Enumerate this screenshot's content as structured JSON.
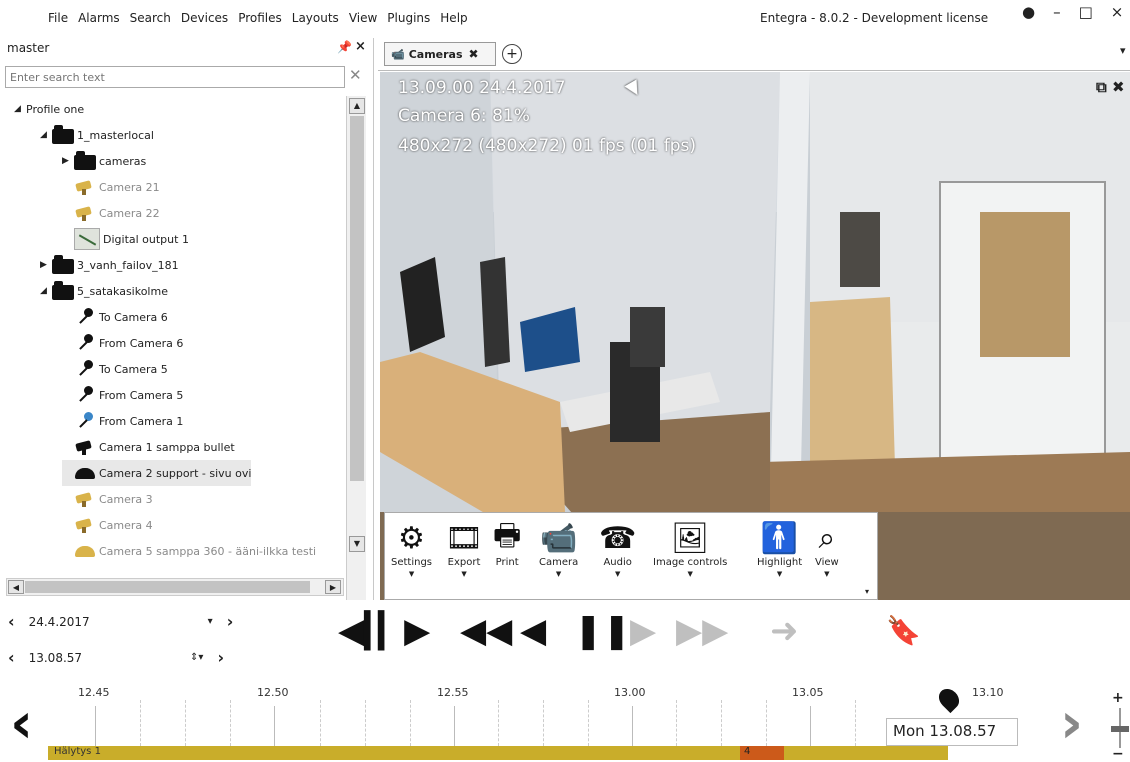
{
  "menu": [
    "File",
    "Alarms",
    "Search",
    "Devices",
    "Profiles",
    "Layouts",
    "View",
    "Plugins",
    "Help"
  ],
  "window_title": "Entegra - 8.0.2 - Development license",
  "left_panel": {
    "title": "master",
    "search_placeholder": "Enter search text",
    "tree": [
      {
        "label": "Profile one",
        "level": 0,
        "arrow": "◢",
        "icon": "none",
        "style": ""
      },
      {
        "label": "1_masterlocal",
        "level": 1,
        "arrow": "◢",
        "icon": "folder",
        "style": ""
      },
      {
        "label": "cameras",
        "level": 2,
        "arrow": "▶",
        "icon": "folder",
        "style": ""
      },
      {
        "label": "Camera 21",
        "level": 2,
        "arrow": "",
        "icon": "camera-yellow",
        "style": "gray"
      },
      {
        "label": "Camera 22",
        "level": 2,
        "arrow": "",
        "icon": "camera-yellow",
        "style": "gray"
      },
      {
        "label": "Digital output 1",
        "level": 2,
        "arrow": "",
        "icon": "digital-output",
        "style": ""
      },
      {
        "label": "3_vanh_failov_181",
        "level": 1,
        "arrow": "▶",
        "icon": "folder",
        "style": ""
      },
      {
        "label": "5_satakasikolme",
        "level": 1,
        "arrow": "◢",
        "icon": "folder",
        "style": ""
      },
      {
        "label": "To Camera 6",
        "level": 2,
        "arrow": "",
        "icon": "microphone",
        "style": ""
      },
      {
        "label": "From Camera 6",
        "level": 2,
        "arrow": "",
        "icon": "microphone",
        "style": ""
      },
      {
        "label": "To Camera 5",
        "level": 2,
        "arrow": "",
        "icon": "microphone",
        "style": ""
      },
      {
        "label": "From Camera 5",
        "level": 2,
        "arrow": "",
        "icon": "microphone",
        "style": ""
      },
      {
        "label": "From Camera 1",
        "level": 2,
        "arrow": "",
        "icon": "microphone-blue",
        "style": ""
      },
      {
        "label": "Camera 1 samppa bullet",
        "level": 2,
        "arrow": "",
        "icon": "camera-black",
        "style": ""
      },
      {
        "label": "Camera 2 support - sivu ovi",
        "level": 2,
        "arrow": "",
        "icon": "dome-camera",
        "style": "sel"
      },
      {
        "label": "Camera 3",
        "level": 2,
        "arrow": "",
        "icon": "camera-yellow",
        "style": "gray"
      },
      {
        "label": "Camera 4",
        "level": 2,
        "arrow": "",
        "icon": "camera-yellow",
        "style": "gray"
      },
      {
        "label": "Camera 5 samppa 360 - ääni-ilkka testi",
        "level": 2,
        "arrow": "",
        "icon": "dome-camera-yellow",
        "style": "gray"
      }
    ]
  },
  "tabs": [
    {
      "label": "Cameras"
    }
  ],
  "video": {
    "osd_time": "13.09.00  24.4.2017",
    "osd_camera": "Camera 6: 81%",
    "osd_res": "480x272 (480x272) 01 fps (01 fps)"
  },
  "toolbar": [
    {
      "label": "Settings",
      "icon": "gear-icon",
      "glyph": "⚙",
      "dd": true
    },
    {
      "label": "Export",
      "icon": "film-icon",
      "glyph": "🎞",
      "dd": true
    },
    {
      "label": "Print",
      "icon": "printer-icon",
      "glyph": "🖶",
      "dd": false
    },
    {
      "label": "Camera",
      "icon": "camera-icon",
      "glyph": "📹",
      "dd": true
    },
    {
      "label": "Audio",
      "icon": "telephone-icon",
      "glyph": "☎",
      "dd": true
    },
    {
      "label": "Image controls",
      "icon": "image-icon",
      "glyph": "🖼",
      "dd": true
    },
    {
      "label": "Highlight",
      "icon": "person-icon",
      "glyph": "🚹",
      "dd": true
    },
    {
      "label": "View",
      "icon": "zoom-icon",
      "glyph": "⌕",
      "dd": true
    }
  ],
  "nav": {
    "date": "24.4.2017",
    "time": "13.08.57"
  },
  "timeline": {
    "ticks": [
      "12.45",
      "12.50",
      "12.55",
      "13.00",
      "13.05",
      "13.10"
    ],
    "tooltip": "Mon 13.08.57",
    "event_label": "Hälytys 1",
    "event_marker": "4"
  }
}
